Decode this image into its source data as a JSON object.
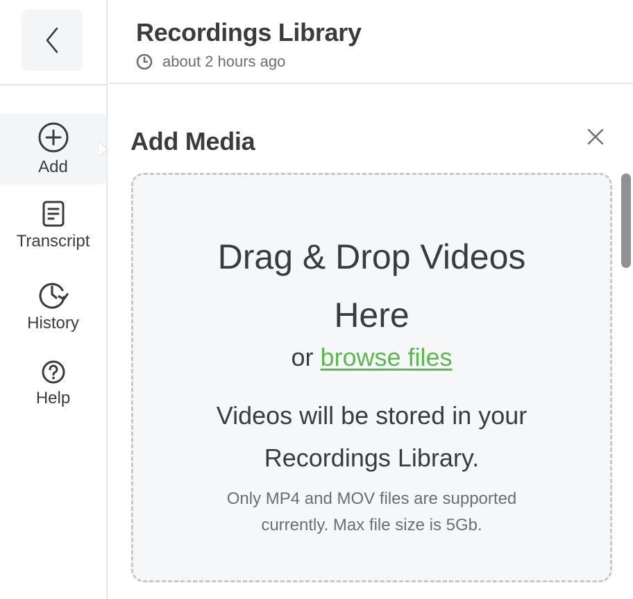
{
  "header": {
    "title": "Recordings Library",
    "timestamp": "about 2 hours ago"
  },
  "sidebar": {
    "back_icon": "chevron-left-icon",
    "items": [
      {
        "label": "Add",
        "icon": "plus-circle-icon",
        "active": true
      },
      {
        "label": "Transcript",
        "icon": "document-icon",
        "active": false
      },
      {
        "label": "History",
        "icon": "history-icon",
        "active": false
      },
      {
        "label": "Help",
        "icon": "question-circle-icon",
        "active": false
      }
    ]
  },
  "panel": {
    "title": "Add Media",
    "close_icon": "close-icon",
    "dropzone": {
      "heading": "Drag & Drop Videos Here",
      "or_text": "or",
      "browse_link": "browse files",
      "stored_text": "Videos will be stored in your Recordings Library.",
      "note": "Only MP4 and MOV files are supported currently. Max file size is 5Gb."
    }
  },
  "colors": {
    "link": "#5cb84d",
    "text": "#3a3b3d",
    "muted": "#6b6d72",
    "dropzone_bg": "#f6f7f9",
    "dropzone_border": "#c6c8cc"
  }
}
